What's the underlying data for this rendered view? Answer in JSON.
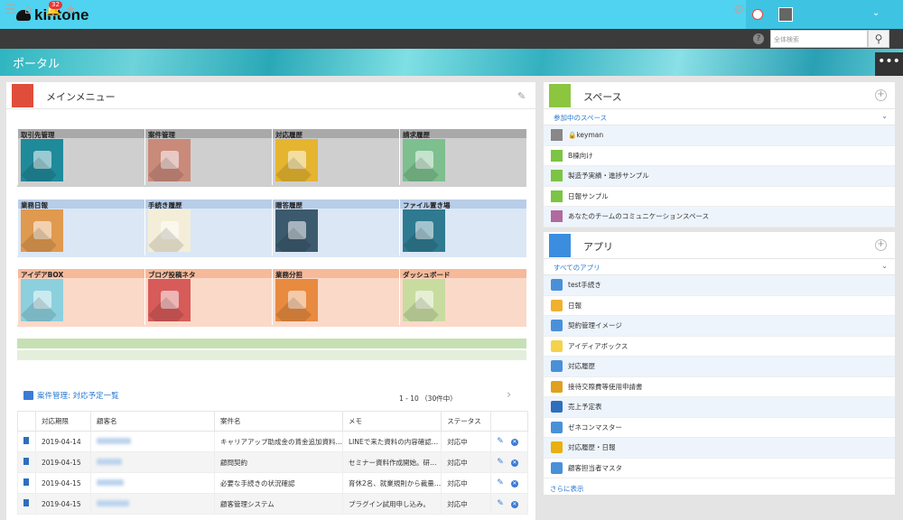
{
  "app": {
    "brand": "kintone",
    "notifications": "32"
  },
  "search": {
    "placeholder": "全体検索"
  },
  "banner": {
    "title": "ポータル",
    "more": "•••"
  },
  "main_menu": {
    "title": "メインメニュー",
    "rows": [
      {
        "bg": "#cfcfcf",
        "head_bg": "#a9a9a9",
        "tiles": [
          {
            "label": "取引先管理",
            "icon": "bank-icon",
            "color": "#1f8a9a"
          },
          {
            "label": "案件管理",
            "icon": "file-box-icon",
            "color": "#c98a7a"
          },
          {
            "label": "対応履歴",
            "icon": "briefcase-icon",
            "color": "#e5b530"
          },
          {
            "label": "請求履歴",
            "icon": "safe-icon",
            "color": "#7dbf8e"
          }
        ]
      },
      {
        "bg": "#dbe7f5",
        "head_bg": "#b7cde8",
        "tiles": [
          {
            "label": "業務日報",
            "icon": "clock-icon",
            "color": "#e09a4f"
          },
          {
            "label": "手続き履歴",
            "icon": "clipboard-icon",
            "color": "#f4eed8"
          },
          {
            "label": "贈答履歴",
            "icon": "gift-icon",
            "color": "#3c5a6e"
          },
          {
            "label": "ファイル置き場",
            "icon": "folder-icon",
            "color": "#2f7a90"
          }
        ]
      },
      {
        "bg": "#fbd9c9",
        "head_bg": "#f6b999",
        "tiles": [
          {
            "label": "アイデアBOX",
            "icon": "island-icon",
            "color": "#8cd0de"
          },
          {
            "label": "ブログ投稿ネタ",
            "icon": "coffee-icon",
            "color": "#d75b59"
          },
          {
            "label": "業務分担",
            "icon": "necktie-icon",
            "color": "#e88a3f"
          },
          {
            "label": "ダッシュボード",
            "icon": "report-icon",
            "color": "#c8dca0"
          }
        ]
      }
    ]
  },
  "record_list": {
    "title": "案件管理: 対応予定一覧",
    "pager": "1 - 10 （30件中）",
    "headers": [
      "対応期限",
      "顧客名",
      "案件名",
      "メモ",
      "ステータス"
    ],
    "rows": [
      {
        "date": "2019-04-14",
        "case": "キャリアアップ助成金の賃金追加資料…",
        "memo": "LINEで来た資料の内容確認…",
        "status": "対応中"
      },
      {
        "date": "2019-04-15",
        "case": "顧問契約",
        "memo": "セミナー資料作成開始。研…",
        "status": "対応中"
      },
      {
        "date": "2019-04-15",
        "case": "必要な手続きの状況確認",
        "memo": "育休2名、就業規則から裁量…",
        "status": "対応中"
      },
      {
        "date": "2019-04-15",
        "case": "顧客管理システム",
        "memo": "プラグイン試用申し込み。",
        "status": "対応中"
      }
    ]
  },
  "spaces": {
    "title": "スペース",
    "sub": "参加中のスペース",
    "items": [
      {
        "label": "🔒keyman",
        "color": "#888"
      },
      {
        "label": "B棟向け",
        "color": "#7cc444"
      },
      {
        "label": "製造予実績・進捗サンプル",
        "color": "#7cc444"
      },
      {
        "label": "日報サンプル",
        "color": "#7cc444"
      },
      {
        "label": "あなたのチームのコミュニケーションスペース",
        "color": "#b06aa0"
      }
    ]
  },
  "apps": {
    "title": "アプリ",
    "sub": "すべてのアプリ",
    "more": "さらに表示",
    "items": [
      {
        "label": "test手続き",
        "color": "#4a90d9"
      },
      {
        "label": "日報",
        "color": "#f0b030"
      },
      {
        "label": "契約管理イメージ",
        "color": "#4a90d9"
      },
      {
        "label": "アイディアボックス",
        "color": "#f6d24a"
      },
      {
        "label": "対応履歴",
        "color": "#4a90d9"
      },
      {
        "label": "接待交際費等使用申請書",
        "color": "#e0a020"
      },
      {
        "label": "売上予定表",
        "color": "#2d6fbd"
      },
      {
        "label": "ゼネコンマスター",
        "color": "#4a90d9"
      },
      {
        "label": "対応履歴・日報",
        "color": "#e8b010"
      },
      {
        "label": "顧客担当者マスタ",
        "color": "#4a90d9"
      }
    ]
  }
}
